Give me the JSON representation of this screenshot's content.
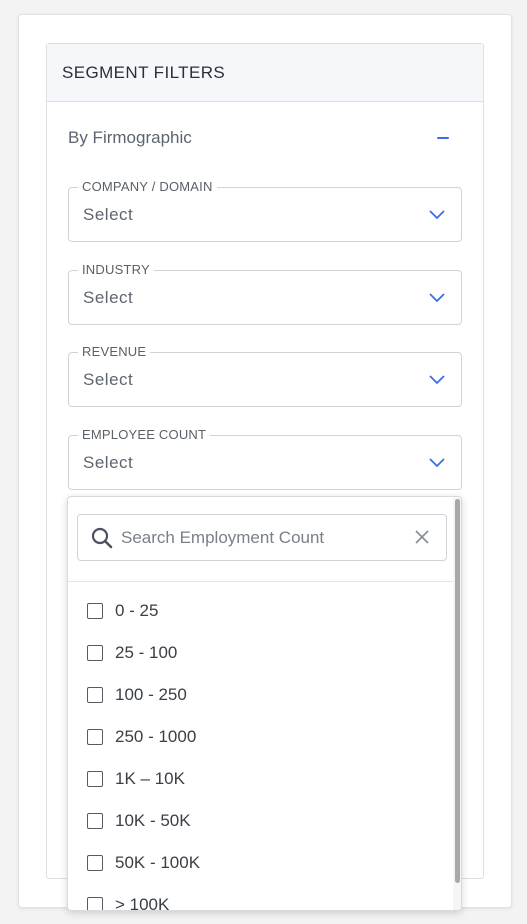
{
  "panel": {
    "title": "SEGMENT FILTERS",
    "section_title": "By Firmographic"
  },
  "fields": [
    {
      "label": "COMPANY / DOMAIN",
      "value": "Select"
    },
    {
      "label": "INDUSTRY",
      "value": "Select"
    },
    {
      "label": "REVENUE",
      "value": "Select"
    },
    {
      "label": "EMPLOYEE COUNT",
      "value": "Select"
    }
  ],
  "dropdown": {
    "search_placeholder": "Search Employment Count",
    "options": [
      {
        "label": "0 - 25",
        "checked": false
      },
      {
        "label": "25 - 100",
        "checked": false
      },
      {
        "label": "100 - 250",
        "checked": false
      },
      {
        "label": "250 - 1000",
        "checked": false
      },
      {
        "label": "1K – 10K",
        "checked": false
      },
      {
        "label": "10K - 50K",
        "checked": false
      },
      {
        "label": "50K - 100K",
        "checked": false
      },
      {
        "label": "> 100K",
        "checked": false
      }
    ]
  },
  "icons": {
    "collapse": "minus-icon",
    "chevron": "chevron-down-icon",
    "search": "search-icon",
    "clear": "close-icon"
  },
  "colors": {
    "accent": "#3a6ee8",
    "header_bg": "#f5f7fb",
    "border": "#cfd3da"
  }
}
